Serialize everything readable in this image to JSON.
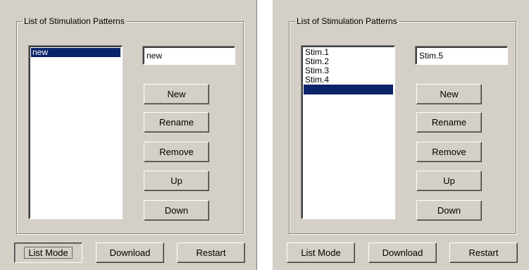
{
  "panels": [
    {
      "group_title": "List of Stimulation Patterns",
      "list_items": [
        "new"
      ],
      "selected_index": 0,
      "name_field_value": "new",
      "buttons": {
        "new": "New",
        "rename": "Rename",
        "remove": "Remove",
        "up": "Up",
        "down": "Down"
      },
      "bottom": {
        "list_mode": "List Mode",
        "download": "Download",
        "restart": "Restart"
      }
    },
    {
      "group_title": "List of Stimulation Patterns",
      "list_items": [
        "Stim.1",
        "Stim.2",
        "Stim.3",
        "Stim.4",
        ""
      ],
      "selected_index": 4,
      "name_field_value": "Stim.5",
      "buttons": {
        "new": "New",
        "rename": "Rename",
        "remove": "Remove",
        "up": "Up",
        "down": "Down"
      },
      "bottom": {
        "list_mode": "List Mode",
        "download": "Download",
        "restart": "Restart"
      }
    }
  ]
}
